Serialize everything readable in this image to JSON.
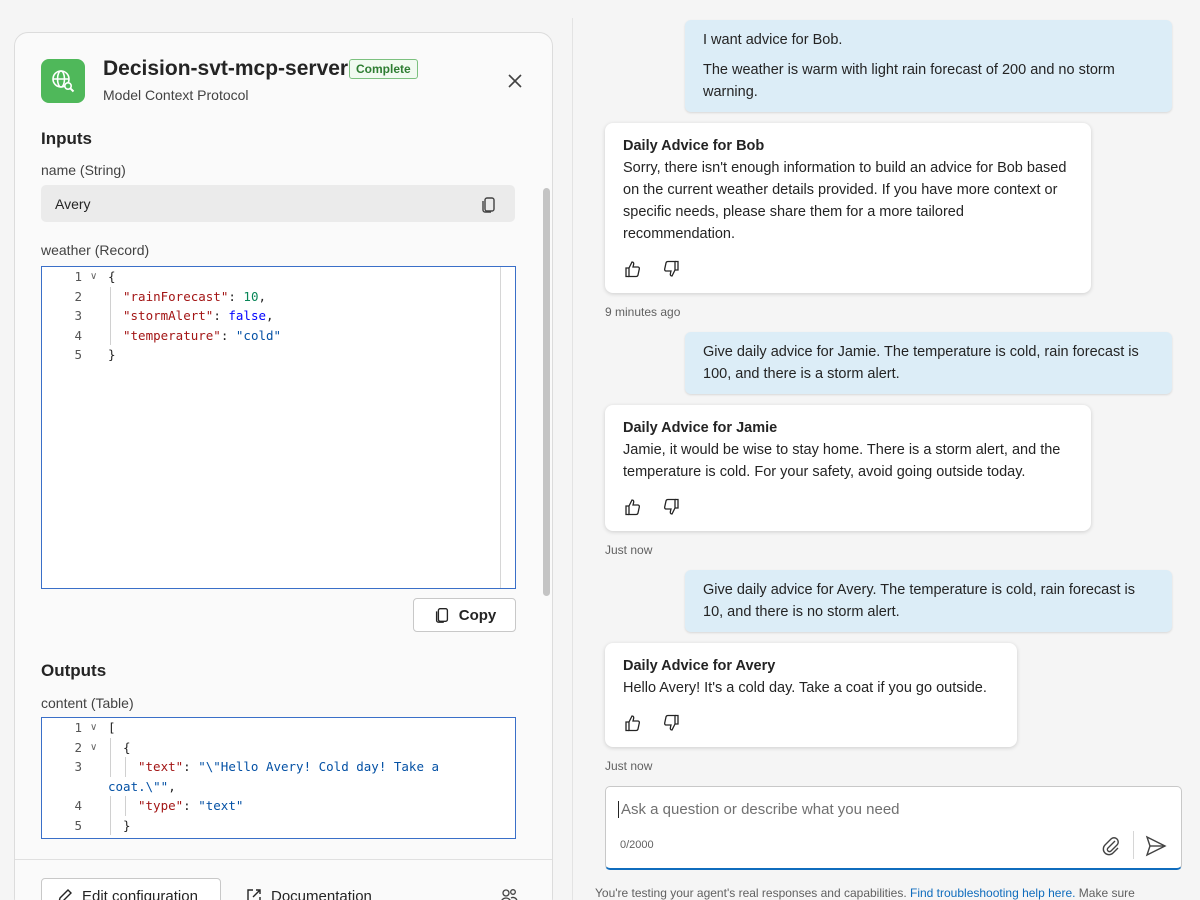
{
  "panel": {
    "title": "Decision-svt-mcp-server",
    "status": "Complete",
    "subtitle": "Model Context Protocol",
    "inputs_heading": "Inputs",
    "outputs_heading": "Outputs",
    "name_label": "name (String)",
    "name_value": "Avery",
    "weather_label": "weather (Record)",
    "content_label": "content (Table)",
    "copy_label": "Copy",
    "edit_label": "Edit configuration",
    "doc_label": "Documentation",
    "weather_code": [
      {
        "ln": "1",
        "parts": [
          [
            "p",
            "{"
          ]
        ]
      },
      {
        "ln": "2",
        "parts": [
          [
            "k",
            "\"rainForecast\""
          ],
          [
            "p",
            ": "
          ],
          [
            "n",
            "10"
          ],
          [
            "p",
            ","
          ]
        ]
      },
      {
        "ln": "3",
        "parts": [
          [
            "k",
            "\"stormAlert\""
          ],
          [
            "p",
            ": "
          ],
          [
            "b",
            "false"
          ],
          [
            "p",
            ","
          ]
        ]
      },
      {
        "ln": "4",
        "parts": [
          [
            "k",
            "\"temperature\""
          ],
          [
            "p",
            ": "
          ],
          [
            "s",
            "\"cold\""
          ]
        ]
      },
      {
        "ln": "5",
        "parts": [
          [
            "p",
            "}"
          ]
        ]
      }
    ],
    "content_code": [
      {
        "ln": "1",
        "parts": [
          [
            "p",
            "["
          ]
        ]
      },
      {
        "ln": "2",
        "parts": [
          [
            "p",
            "{"
          ]
        ]
      },
      {
        "ln": "3",
        "parts": [
          [
            "k",
            "\"text\""
          ],
          [
            "p",
            ": "
          ],
          [
            "s",
            "\"\\\"Hello Avery! Cold day! Take a"
          ]
        ]
      },
      {
        "ln": "",
        "parts": [
          [
            "s",
            "coat.\\\"\""
          ],
          [
            "p",
            ","
          ]
        ]
      },
      {
        "ln": "4",
        "parts": [
          [
            "k",
            "\"type\""
          ],
          [
            "p",
            ": "
          ],
          [
            "s",
            "\"text\""
          ]
        ]
      },
      {
        "ln": "5",
        "parts": [
          [
            "p",
            "}"
          ]
        ]
      }
    ]
  },
  "chat": {
    "messages": {
      "u1_line1": "I want advice for Bob.",
      "u1_line2": "The weather is warm with light rain forecast of 200 and no storm warning.",
      "b1_title": "Daily Advice for Bob",
      "b1_body": "Sorry, there isn't enough information to build an advice for Bob based on the current weather details provided. If you have more context or specific needs, please share them for a more tailored recommendation.",
      "b1_time": "9 minutes ago",
      "u2": "Give daily advice for Jamie. The temperature is cold, rain forecast is 100, and there is a storm alert.",
      "b2_title": "Daily Advice for Jamie",
      "b2_body": "Jamie, it would be wise to stay home. There is a storm alert, and the temperature is cold. For your safety, avoid going outside today.",
      "b2_time": "Just now",
      "u3": "Give daily advice for Avery. The temperature is cold, rain forecast is 10, and there is no storm alert.",
      "b3_title": "Daily Advice for Avery",
      "b3_body": "Hello Avery! It's a cold day. Take a coat if you go outside.",
      "b3_time": "Just now"
    },
    "composer": {
      "placeholder": "Ask a question or describe what you need",
      "char_count": "0/2000"
    },
    "disclaimer_prefix": "You're testing your agent's real responses and capabilities. ",
    "disclaimer_link": "Find troubleshooting help here.",
    "disclaimer_suffix": " Make sure"
  },
  "colors": {
    "accent": "#0f6cbd",
    "user_bubble": "#dcedf7",
    "app_icon": "#4fb85a",
    "status_green": "#2e7d32"
  },
  "icons": [
    "globe-search-icon",
    "close-icon",
    "copy-icon",
    "thumbs-up-icon",
    "thumbs-down-icon",
    "paperclip-icon",
    "send-icon",
    "edit-icon",
    "external-link-icon",
    "people-icon"
  ]
}
